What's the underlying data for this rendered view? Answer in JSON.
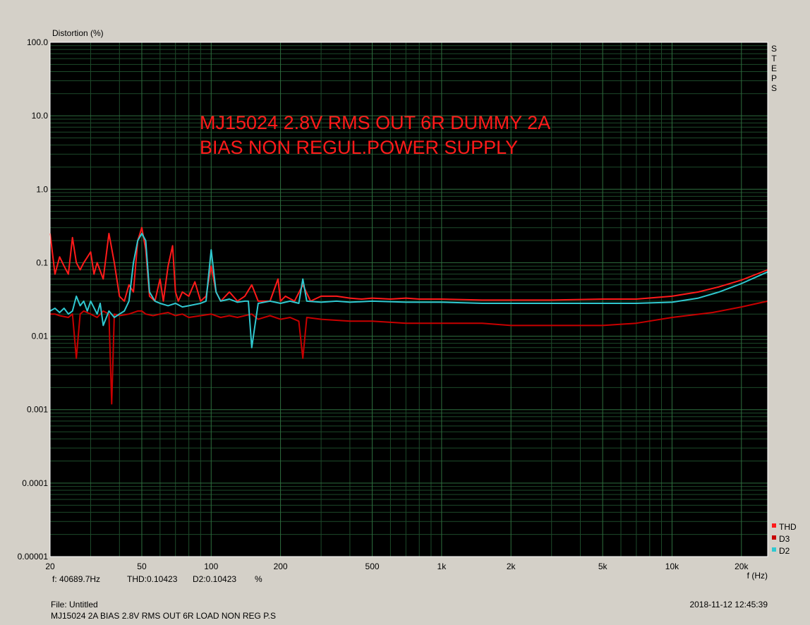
{
  "chart_data": {
    "type": "line",
    "ylabel": "Distortion (%)",
    "xlabel": "f (Hz)",
    "x_scale": "log",
    "y_scale": "log",
    "xlim": [
      20,
      26000
    ],
    "ylim": [
      1e-05,
      100
    ],
    "x_ticks": [
      {
        "v": 20,
        "label": "20"
      },
      {
        "v": 50,
        "label": "50"
      },
      {
        "v": 100,
        "label": "100"
      },
      {
        "v": 200,
        "label": "200"
      },
      {
        "v": 500,
        "label": "500"
      },
      {
        "v": 1000,
        "label": "1k"
      },
      {
        "v": 2000,
        "label": "2k"
      },
      {
        "v": 5000,
        "label": "5k"
      },
      {
        "v": 10000,
        "label": "10k"
      },
      {
        "v": 20000,
        "label": "20k"
      }
    ],
    "y_ticks": [
      {
        "v": 100,
        "label": "100.0"
      },
      {
        "v": 10,
        "label": "10.0"
      },
      {
        "v": 1,
        "label": "1.0"
      },
      {
        "v": 0.1,
        "label": "0.1"
      },
      {
        "v": 0.01,
        "label": "0.01"
      },
      {
        "v": 0.001,
        "label": "0.001"
      },
      {
        "v": 0.0001,
        "label": "0.0001"
      },
      {
        "v": 1e-05,
        "label": "0.00001"
      }
    ],
    "grid": true,
    "legend_position": "bottom-right",
    "annotation": [
      "MJ15024 2.8V RMS OUT 6R DUMMY 2A",
      "BIAS NON REGUL.POWER SUPPLY"
    ],
    "series": [
      {
        "name": "THD",
        "color": "#ff1a1a",
        "x": [
          20,
          21,
          22,
          23,
          24,
          25,
          26,
          27,
          28,
          30,
          31,
          32,
          34,
          36,
          38,
          40,
          42,
          44,
          46,
          48,
          50,
          52,
          54,
          57,
          60,
          62,
          65,
          68,
          70,
          72,
          75,
          80,
          85,
          90,
          95,
          100,
          105,
          110,
          120,
          130,
          140,
          150,
          160,
          180,
          195,
          200,
          210,
          230,
          250,
          270,
          300,
          350,
          400,
          450,
          500,
          600,
          700,
          800,
          1000,
          1500,
          2000,
          3000,
          5000,
          7000,
          10000,
          13000,
          16000,
          20000,
          26000
        ],
        "y": [
          0.25,
          0.07,
          0.12,
          0.09,
          0.07,
          0.22,
          0.1,
          0.08,
          0.1,
          0.14,
          0.07,
          0.1,
          0.06,
          0.25,
          0.1,
          0.035,
          0.03,
          0.05,
          0.04,
          0.2,
          0.3,
          0.15,
          0.035,
          0.03,
          0.06,
          0.03,
          0.09,
          0.17,
          0.04,
          0.03,
          0.04,
          0.035,
          0.055,
          0.03,
          0.035,
          0.09,
          0.04,
          0.03,
          0.04,
          0.03,
          0.035,
          0.05,
          0.03,
          0.03,
          0.06,
          0.03,
          0.035,
          0.03,
          0.05,
          0.03,
          0.035,
          0.035,
          0.033,
          0.032,
          0.033,
          0.032,
          0.033,
          0.032,
          0.032,
          0.031,
          0.031,
          0.031,
          0.032,
          0.032,
          0.035,
          0.04,
          0.047,
          0.058,
          0.08
        ]
      },
      {
        "name": "D3",
        "color": "#c80000",
        "x": [
          20,
          21,
          22,
          24,
          25,
          26,
          27,
          28,
          30,
          32,
          34,
          36,
          37,
          38,
          40,
          44,
          48,
          50,
          52,
          56,
          60,
          65,
          70,
          75,
          80,
          90,
          100,
          110,
          120,
          130,
          150,
          160,
          180,
          200,
          220,
          240,
          250,
          260,
          300,
          400,
          500,
          700,
          1000,
          1500,
          2000,
          3000,
          5000,
          7000,
          10000,
          15000,
          20000,
          26000
        ],
        "y": [
          0.02,
          0.02,
          0.019,
          0.018,
          0.02,
          0.005,
          0.02,
          0.022,
          0.02,
          0.018,
          0.022,
          0.02,
          0.0012,
          0.02,
          0.019,
          0.02,
          0.022,
          0.022,
          0.02,
          0.019,
          0.02,
          0.021,
          0.019,
          0.02,
          0.018,
          0.019,
          0.02,
          0.018,
          0.019,
          0.018,
          0.02,
          0.017,
          0.019,
          0.017,
          0.018,
          0.016,
          0.005,
          0.018,
          0.017,
          0.016,
          0.016,
          0.015,
          0.015,
          0.015,
          0.014,
          0.014,
          0.014,
          0.015,
          0.018,
          0.021,
          0.025,
          0.03
        ]
      },
      {
        "name": "D2",
        "color": "#30c8d0",
        "x": [
          20,
          21,
          22,
          23,
          24,
          25,
          26,
          27,
          28,
          29,
          30,
          32,
          33,
          34,
          36,
          38,
          40,
          42,
          44,
          46,
          48,
          50,
          52,
          54,
          57,
          60,
          65,
          70,
          75,
          80,
          90,
          95,
          100,
          105,
          110,
          120,
          130,
          140,
          145,
          150,
          160,
          180,
          200,
          220,
          240,
          250,
          260,
          300,
          350,
          400,
          500,
          700,
          1000,
          1500,
          2000,
          3000,
          5000,
          7000,
          10000,
          13000,
          16000,
          20000,
          26000
        ],
        "y": [
          0.022,
          0.024,
          0.021,
          0.024,
          0.02,
          0.022,
          0.035,
          0.026,
          0.03,
          0.022,
          0.03,
          0.02,
          0.028,
          0.014,
          0.022,
          0.018,
          0.02,
          0.022,
          0.03,
          0.1,
          0.2,
          0.25,
          0.2,
          0.04,
          0.03,
          0.028,
          0.026,
          0.028,
          0.025,
          0.026,
          0.028,
          0.03,
          0.15,
          0.04,
          0.03,
          0.032,
          0.029,
          0.03,
          0.03,
          0.007,
          0.028,
          0.03,
          0.028,
          0.03,
          0.028,
          0.06,
          0.03,
          0.029,
          0.03,
          0.029,
          0.03,
          0.029,
          0.029,
          0.028,
          0.028,
          0.028,
          0.028,
          0.028,
          0.029,
          0.033,
          0.04,
          0.052,
          0.075
        ]
      }
    ]
  },
  "right_label": "STEPS",
  "status": {
    "cursor_freq": "f: 40689.7Hz",
    "thd": "THD:0.10423",
    "d2": "D2:0.10423",
    "unit": "%",
    "file": "File: Untitled",
    "description": "MJ15024 2A BIAS 2.8V RMS OUT 6R LOAD NON REG P.S",
    "timestamp": "2018-11-12 12:45:39"
  }
}
